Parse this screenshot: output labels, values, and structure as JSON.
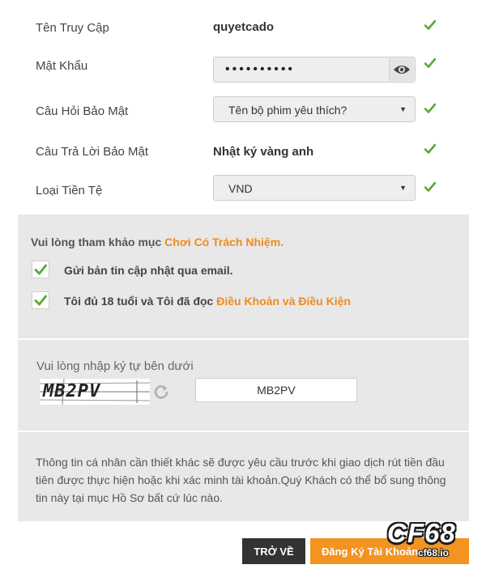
{
  "form": {
    "username": {
      "label": "Tên Truy Cập",
      "value": "quyetcado"
    },
    "password": {
      "label": "Mật Khẩu",
      "value": "••••••••••"
    },
    "security_question": {
      "label": "Câu Hỏi Bảo Mật",
      "selected": "Tên bộ phim yêu thích?"
    },
    "security_answer": {
      "label": "Câu Trả Lời Bảo Mật",
      "value": "Nhật ký vàng anh"
    },
    "currency": {
      "label": "Loại Tiền Tệ",
      "selected": "VND"
    }
  },
  "responsible": {
    "prefix": "Vui lòng tham khảo mục ",
    "link": "Chơi Có Trách Nhiệm."
  },
  "checkboxes": {
    "newsletter": "Gửi bản tin cập nhật qua email.",
    "terms_prefix": "Tôi đủ 18 tuổi và Tôi đã đọc ",
    "terms_link": "Điều Khoản và Điều Kiện"
  },
  "captcha": {
    "label": "Vui lòng nhập ký tự bên dưới",
    "image_text": "MB2PV",
    "input_value": "MB2PV"
  },
  "info_text": "Thông tin cá nhân cần thiết khác sẽ được yêu cầu trước khi giao dịch rút tiền đầu tiên được thực hiện hoặc khi xác minh tài khoản.Quý Khách có thể bổ sung thông tin này tại mục Hồ Sơ bất cứ lúc nào.",
  "buttons": {
    "back": "TRỞ VỀ",
    "register": "Đăng Ký Tài Khoản"
  },
  "watermark": {
    "logo": "CF68",
    "domain": "cf68.io"
  },
  "colors": {
    "accent_orange": "#f39321",
    "link_orange": "#f08a1c",
    "check_green": "#5aa832",
    "panel_grey": "#e8e8e8"
  },
  "icons": {
    "valid": "check-icon",
    "show_password": "eye-icon",
    "dropdown": "caret-down-icon",
    "refresh": "refresh-icon"
  }
}
